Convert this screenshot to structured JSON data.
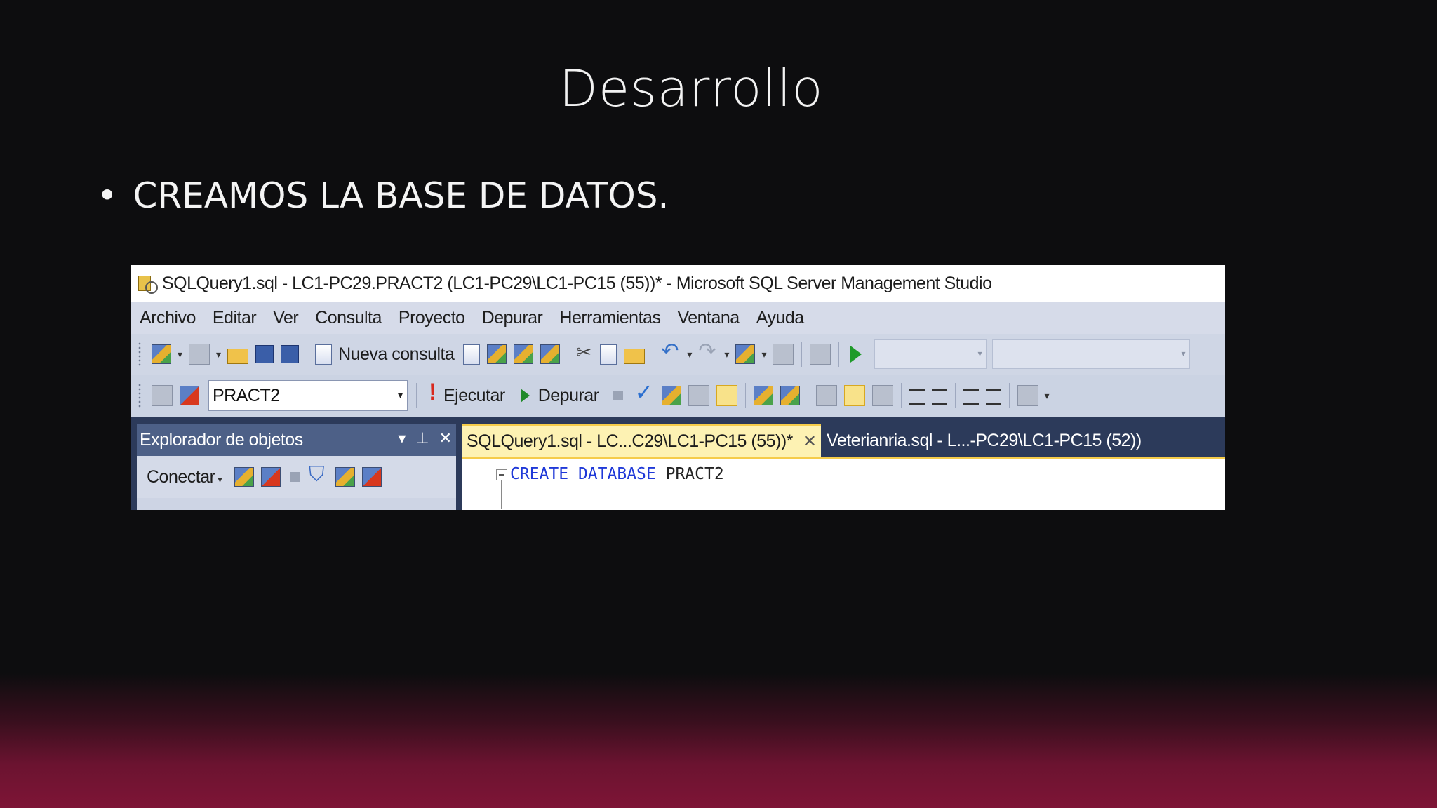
{
  "slide": {
    "title": "Desarrollo",
    "bullet": "CREAMOS LA BASE DE DATOS."
  },
  "window": {
    "title": "SQLQuery1.sql - LC1-PC29.PRACT2 (LC1-PC29\\LC1-PC15 (55))* - Microsoft SQL Server Management Studio"
  },
  "menu": {
    "items": [
      "Archivo",
      "Editar",
      "Ver",
      "Consulta",
      "Proyecto",
      "Depurar",
      "Herramientas",
      "Ventana",
      "Ayuda"
    ]
  },
  "toolbar1": {
    "new_query_label": "Nueva consulta"
  },
  "toolbar2": {
    "database": "PRACT2",
    "execute_label": "Ejecutar",
    "debug_label": "Depurar"
  },
  "object_explorer": {
    "title": "Explorador de objetos",
    "connect_label": "Conectar"
  },
  "tabs": [
    {
      "label": "SQLQuery1.sql - LC...C29\\LC1-PC15 (55))*",
      "active": true
    },
    {
      "label": "Veterianria.sql - L...-PC29\\LC1-PC15 (52))",
      "active": false
    }
  ],
  "editor": {
    "kw1": "CREATE",
    "kw2": "DATABASE",
    "name": "PRACT2"
  },
  "colors": {
    "slide_bg": "#0d0d0f",
    "slide_accent": "#7e1536",
    "keyword": "#1f39d8",
    "active_tab": "#fdf2b3",
    "panel_header": "#4d6087"
  }
}
